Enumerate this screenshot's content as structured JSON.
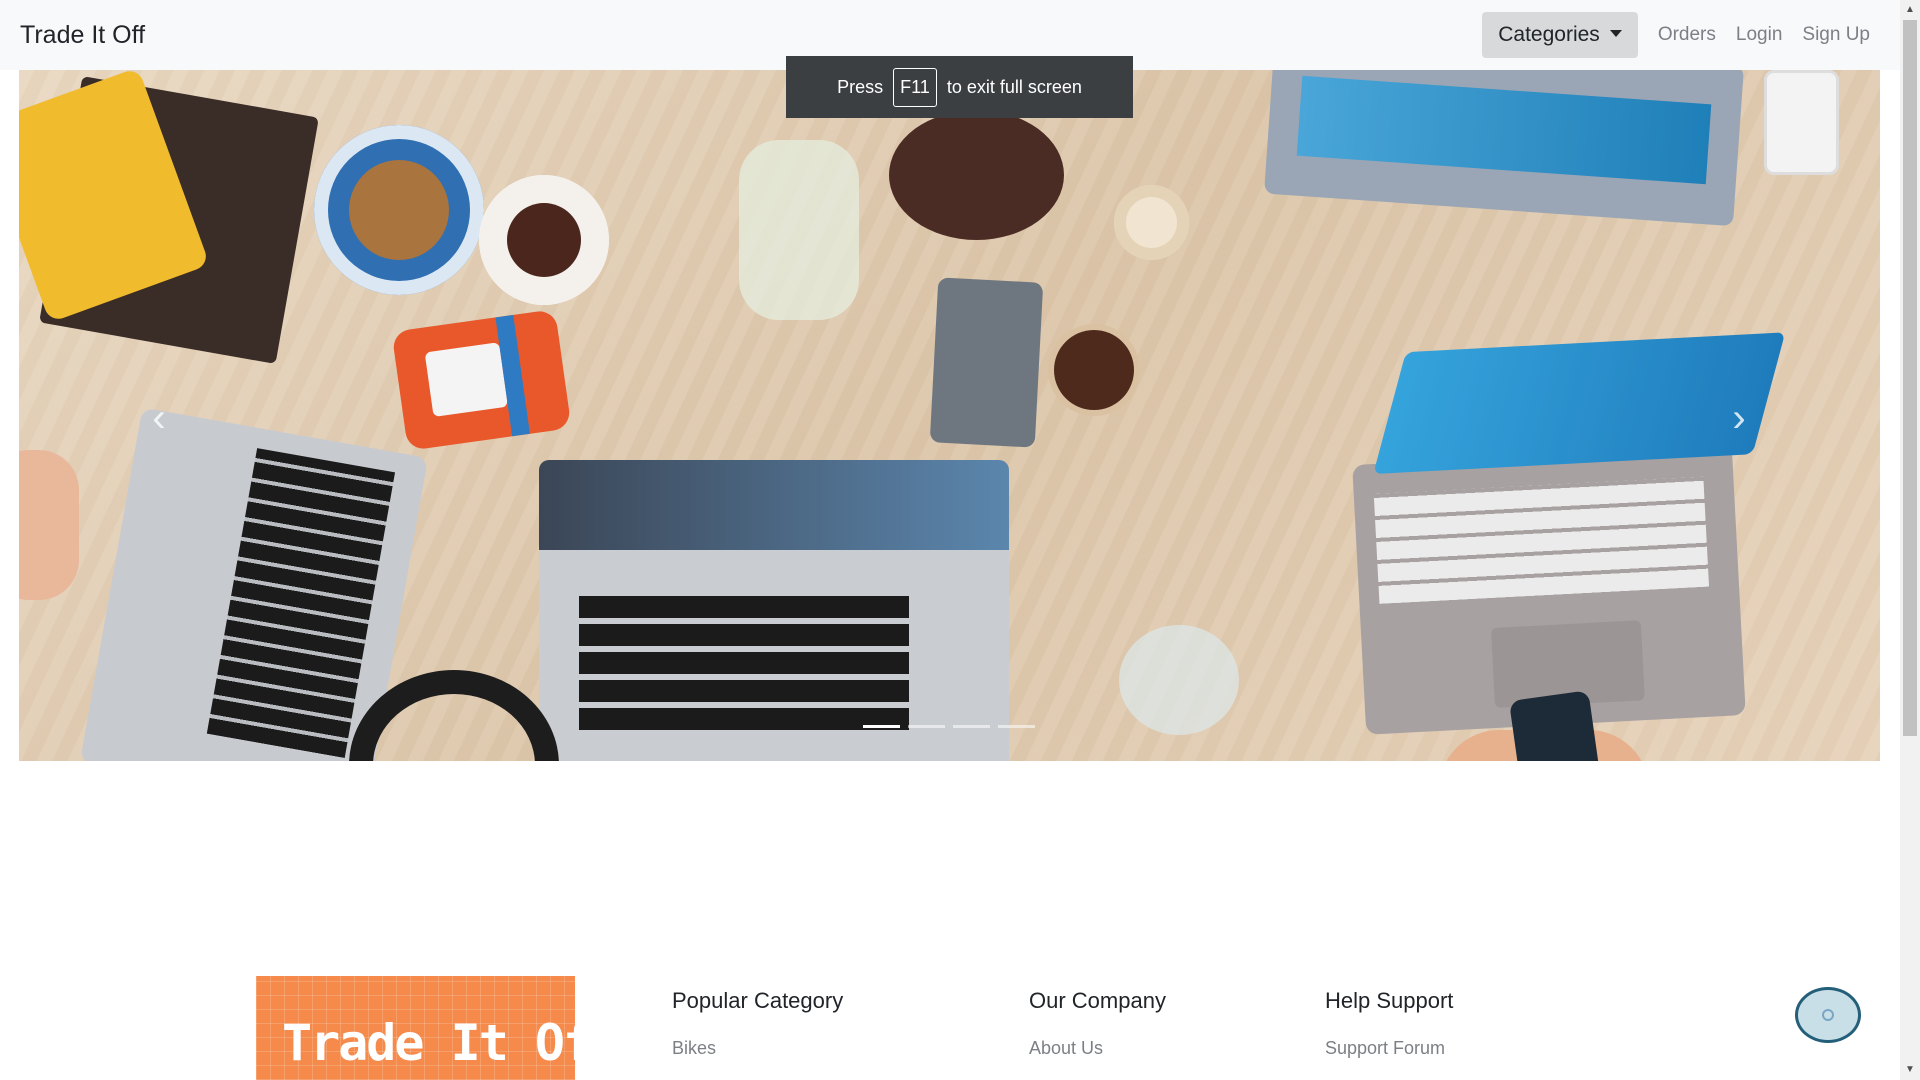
{
  "navbar": {
    "brand": "Trade It Off",
    "categories_label": "Categories",
    "orders_label": "Orders",
    "login_label": "Login",
    "signup_label": "Sign Up"
  },
  "fullscreen_notice": {
    "before": "Press",
    "key": "F11",
    "after": "to exit full screen"
  },
  "carousel": {
    "prev_icon": "chevron-left-icon",
    "next_icon": "chevron-right-icon",
    "prev_glyph": "‹",
    "next_glyph": "›",
    "slide_count": 4,
    "active_slide": 1
  },
  "footer": {
    "logo_text": "Trade It Off",
    "columns": [
      {
        "heading": "Popular Category",
        "links": [
          "Bikes"
        ]
      },
      {
        "heading": "Our Company",
        "links": [
          "About Us"
        ]
      },
      {
        "heading": "Help Support",
        "links": [
          "Support Forum"
        ]
      }
    ]
  },
  "scrollbar": {
    "up_glyph": "▲",
    "down_glyph": "▼"
  },
  "colors": {
    "navbar_bg": "#f8f9fa",
    "dropdown_bg": "#d7d9db",
    "logo_bg": "#f58a4b",
    "notice_bg": "#3c3f42"
  }
}
